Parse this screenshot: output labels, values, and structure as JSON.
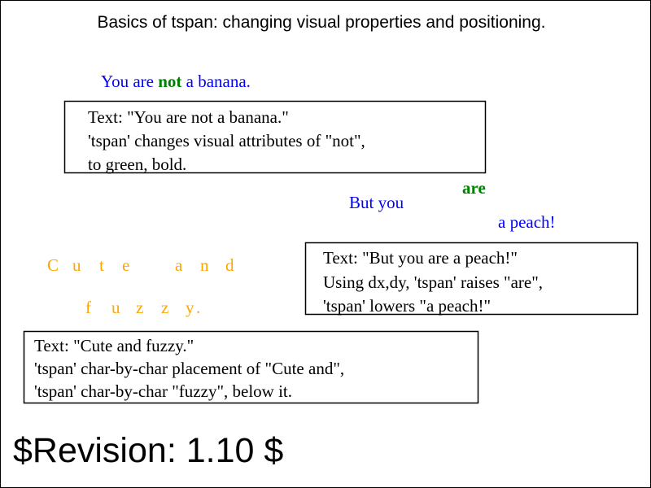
{
  "title": "Basics of tspan: changing visual properties and positioning.",
  "revision": "$Revision: 1.10 $",
  "colors": {
    "blue": "#0000ff",
    "green": "#008000",
    "orange": "#ffa500",
    "black": "#000000"
  },
  "demo1": {
    "before": "You are",
    "highlight": "not",
    "after": "a banana."
  },
  "caption1": {
    "line1": "Text: \"You are not a banana.\"",
    "line2": "'tspan' changes visual attributes of \"not\",",
    "line3": "to green, bold."
  },
  "demo2": {
    "start": "But you",
    "raised": "are",
    "lowered": "a peach!"
  },
  "caption2": {
    "line1": "Text: \"But you are a peach!\"",
    "line2": "Using dx,dy, 'tspan' raises \"are\",",
    "line3": "'tspan' lowers \"a peach!\""
  },
  "demo3": {
    "row1": [
      "C",
      "u",
      "t",
      "e",
      "a",
      "n",
      "d"
    ],
    "row2": [
      "f",
      "u",
      "z",
      "z",
      "y",
      "."
    ]
  },
  "caption3": {
    "line1": "Text: \"Cute and fuzzy.\"",
    "line2": "'tspan' char-by-char placement of \"Cute and\",",
    "line3": "'tspan' char-by-char \"fuzzy\", below it."
  }
}
